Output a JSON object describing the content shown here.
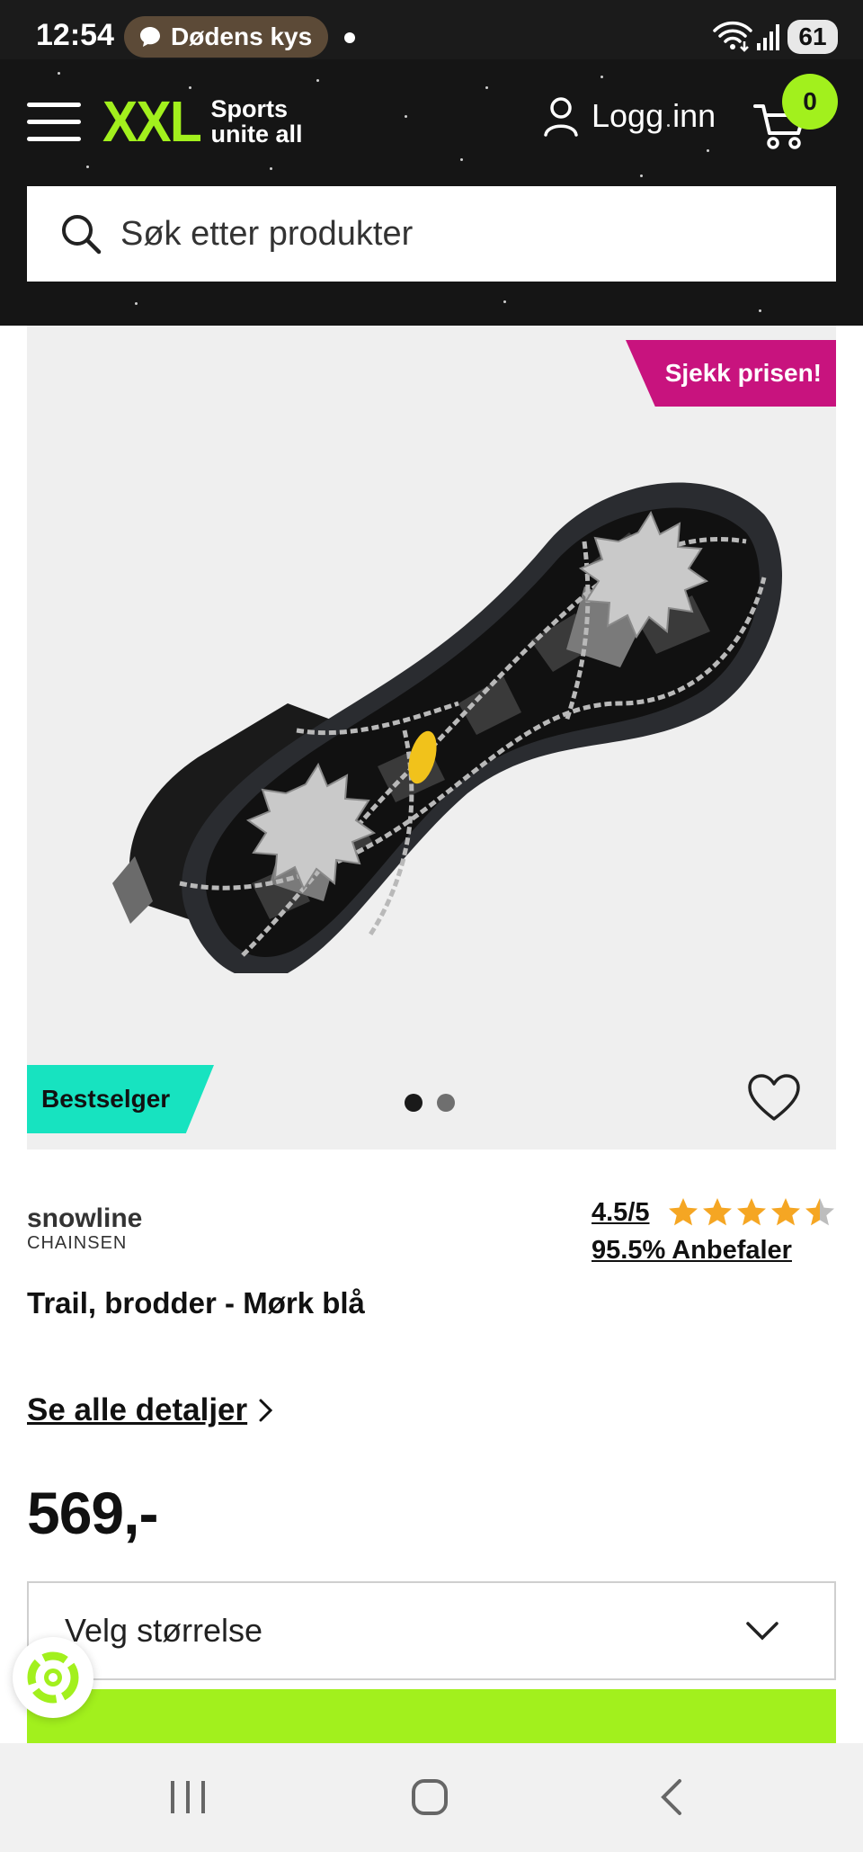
{
  "status_bar": {
    "time": "12:54",
    "media_text": "Dødens kys",
    "battery": "61"
  },
  "header": {
    "logo_text": "XXL",
    "tagline_line1": "Sports",
    "tagline_line2": "unite all",
    "login_label": "Logg inn",
    "cart_count": "0",
    "accent_color": "#a2f01d",
    "background": "#151515"
  },
  "search": {
    "placeholder": "Søk etter produkter",
    "icon": "search-icon"
  },
  "gallery": {
    "promo_badge": "Sjekk prisen!",
    "promo_color": "#c8137e",
    "bestseller_badge": "Bestselger",
    "bestseller_color": "#17e3c0",
    "slide_count": 2,
    "active_slide": 1
  },
  "product": {
    "brand_name": "snowline",
    "brand_sub": "CHAINSEN",
    "rating_text": "4.5/5",
    "rating_value": 4.5,
    "rating_max": 5,
    "star_color": "#f5a623",
    "recommend_text": "95.5% Anbefaler",
    "title": "Trail, brodder - Mørk blå",
    "details_link": "Se alle detaljer",
    "price": "569,-",
    "size_placeholder": "Velg størrelse"
  }
}
